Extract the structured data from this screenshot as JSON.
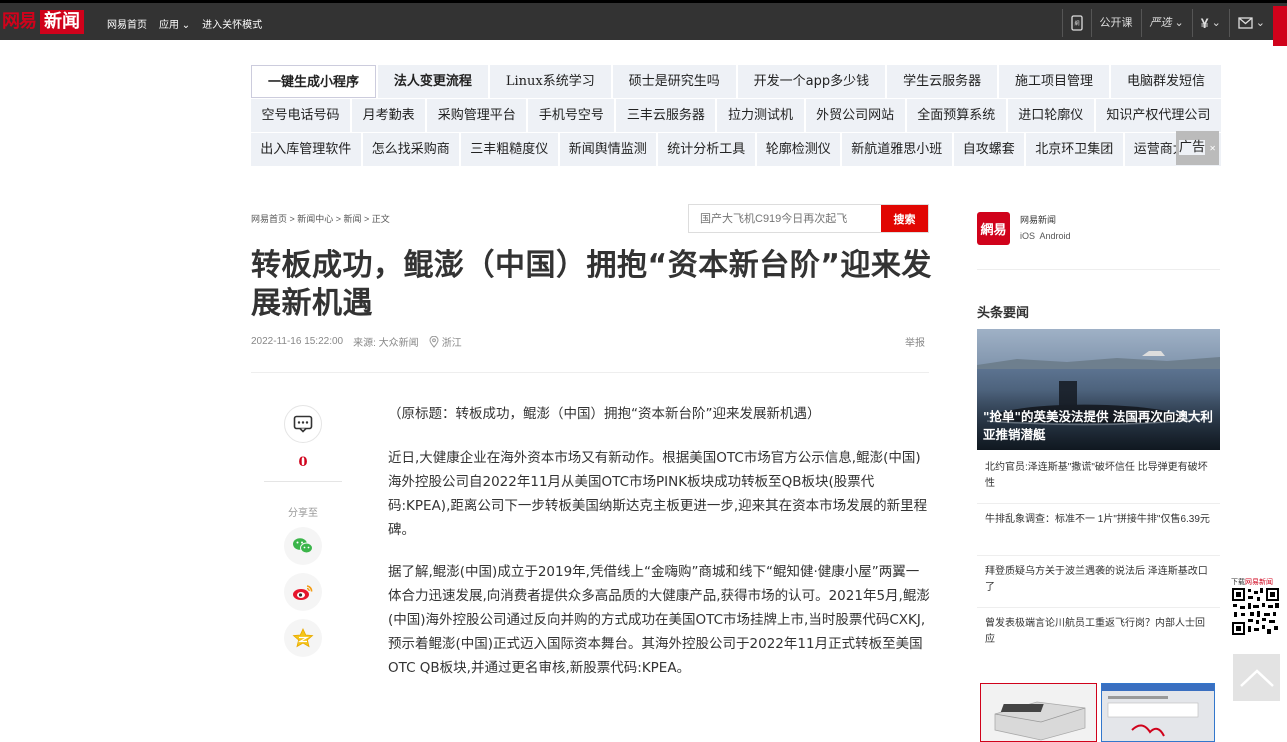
{
  "topbar": {
    "logo_wangyi": "网易",
    "logo_news": "新闻",
    "nav": [
      "网易首页",
      "应用",
      "进入关怀模式"
    ],
    "right": [
      "公开课",
      "严选",
      "¥",
      ""
    ]
  },
  "ads": {
    "rows": [
      [
        "一键生成小程序",
        "法人变更流程",
        "Linux系统学习",
        "硕士是研究生吗",
        "开发一个app多少钱",
        "学生云服务器",
        "施工项目管理",
        "电脑群发短信"
      ],
      [
        "空号电话号码",
        "月考勤表",
        "采购管理平台",
        "手机号空号",
        "三丰云服务器",
        "拉力测试机",
        "外贸公司网站",
        "全面预算系统",
        "进口轮廓仪",
        "知识产权代理公司"
      ],
      [
        "出入库管理软件",
        "怎么找采购商",
        "三丰粗糙度仪",
        "新闻舆情监测",
        "统计分析工具",
        "轮廓检测仪",
        "新航道雅思小班",
        "自攻螺套",
        "北京环卫集团",
        "运营商大数据"
      ]
    ],
    "tag": "广告"
  },
  "breadcrumb": "网易首页 > 新闻中心 > 新闻 > 正文",
  "search": {
    "placeholder": "国产大飞机C919今日再次起飞",
    "button": "搜索"
  },
  "article": {
    "title": "转板成功，鲲澎（中国）拥抱“资本新台阶”迎来发展新机遇",
    "datetime": "2022-11-16 15:22:00",
    "source": "来源: 大众新闻",
    "location": "浙江",
    "report": "举报",
    "paragraphs": [
      "（原标题：转板成功，鲲澎（中国）拥抱“资本新台阶”迎来发展新机遇）",
      "近日,大健康企业在海外资本市场又有新动作。根据美国OTC市场官方公示信息,鲲澎(中国)海外控股公司自2022年11月从美国OTC市场PINK板块成功转板至QB板块(股票代码:KPEA),距离公司下一步转板美国纳斯达克主板更进一步,迎来其在资本市场发展的新里程碑。",
      "据了解,鲲澎(中国)成立于2019年,凭借线上“金嗨购”商城和线下“鲲知健·健康小屋”两翼一体合力迅速发展,向消费者提供众多高品质的大健康产品,获得市场的认可。2021年5月,鲲澎(中国)海外控股公司通过反向并购的方式成功在美国OTC市场挂牌上市,当时股票代码CXKJ,预示着鲲澎(中国)正式迈入国际资本舞台。其海外控股公司于2022年11月正式转板至美国OTC QB板块,并通过更名审核,新股票代码:KPEA。"
    ]
  },
  "sidebar_left": {
    "comment_count": "0",
    "share_label": "分享至"
  },
  "app_promo": {
    "logo": "網易",
    "name": "网易新闻",
    "platforms": "iOS  Android"
  },
  "headlines": {
    "title": "头条要闻",
    "hero_caption": "\"抢单\"的英美没法提供 法国再次向澳大利亚推销潜艇",
    "items": [
      "北约官员:泽连斯基\"撒谎\"破坏信任 比导弹更有破坏性",
      "牛排乱象调查：标准不一 1片\"拼接牛排\"仅售6.39元",
      "拜登质疑乌方关于波兰遇袭的说法后 泽连斯基改口了",
      "曾发表极端言论川航员工重返飞行岗？内部人士回应"
    ]
  },
  "qr": {
    "label_prefix": "下载",
    "label_brand": "网易新闻"
  },
  "colors": {
    "brand_red": "#d0021b",
    "topbar": "#333333",
    "search_button": "#e10602"
  }
}
